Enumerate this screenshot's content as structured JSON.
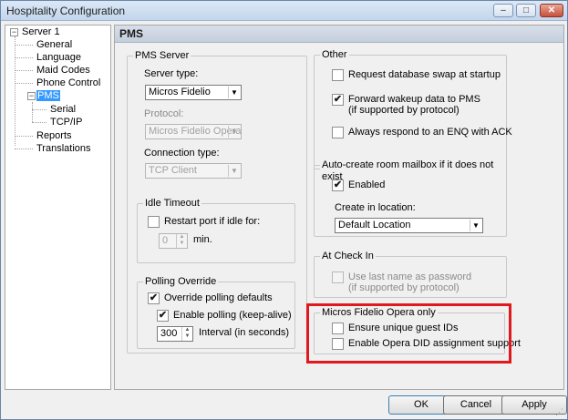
{
  "window": {
    "title": "Hospitality Configuration",
    "min_icon": "–",
    "max_icon": "□",
    "close_icon": "✕"
  },
  "tree": {
    "root": "Server 1",
    "items": [
      "General",
      "Language",
      "Maid Codes",
      "Phone Control",
      "PMS",
      "Serial",
      "TCP/IP",
      "Reports",
      "Translations"
    ],
    "selected": "PMS",
    "expander_symbol": "−"
  },
  "panel": {
    "title": "PMS"
  },
  "pms_server": {
    "title": "PMS Server",
    "server_type_label": "Server type:",
    "server_type_value": "Micros Fidelio",
    "protocol_label": "Protocol:",
    "protocol_value": "Micros Fidelio Opera",
    "connection_type_label": "Connection type:",
    "connection_type_value": "TCP Client"
  },
  "idle_timeout": {
    "title": "Idle Timeout",
    "restart_label": "Restart port if idle for:",
    "restart_checked": false,
    "minutes_value": "0",
    "minutes_unit": "min."
  },
  "polling_override": {
    "title": "Polling Override",
    "override_label": "Override polling defaults",
    "override_checked": true,
    "enable_label": "Enable polling (keep-alive)",
    "enable_checked": true,
    "interval_value": "300",
    "interval_label": "Interval (in seconds)"
  },
  "other": {
    "title": "Other",
    "request_swap_label": "Request database swap at startup",
    "request_swap_checked": false,
    "forward_wakeup_label_1": "Forward wakeup data to PMS",
    "forward_wakeup_label_2": "(if supported by protocol)",
    "forward_wakeup_checked": true,
    "respond_enq_label": "Always respond to an ENQ with ACK",
    "respond_enq_checked": false
  },
  "auto_create": {
    "title": "Auto-create room mailbox if it does not exist",
    "enabled_label": "Enabled",
    "enabled_checked": true,
    "location_label": "Create in location:",
    "location_value": "Default Location"
  },
  "at_check_in": {
    "title": "At Check In",
    "use_last_name_label_1": "Use last name as password",
    "use_last_name_label_2": "(if supported by protocol)",
    "use_last_name_checked": false
  },
  "opera_only": {
    "title": "Micros Fidelio Opera only",
    "unique_ids_label": "Ensure unique guest IDs",
    "unique_ids_checked": false,
    "did_support_label": "Enable Opera DID assignment support",
    "did_support_checked": false
  },
  "buttons": {
    "ok": "OK",
    "cancel": "Cancel",
    "apply": "Apply"
  },
  "glyphs": {
    "check": "✔",
    "dropdown": "▼",
    "spin_up": "▲",
    "spin_down": "▼",
    "grip": "⋰"
  },
  "colors": {
    "highlight_box": "#e0191e",
    "selection": "#3399ff"
  }
}
